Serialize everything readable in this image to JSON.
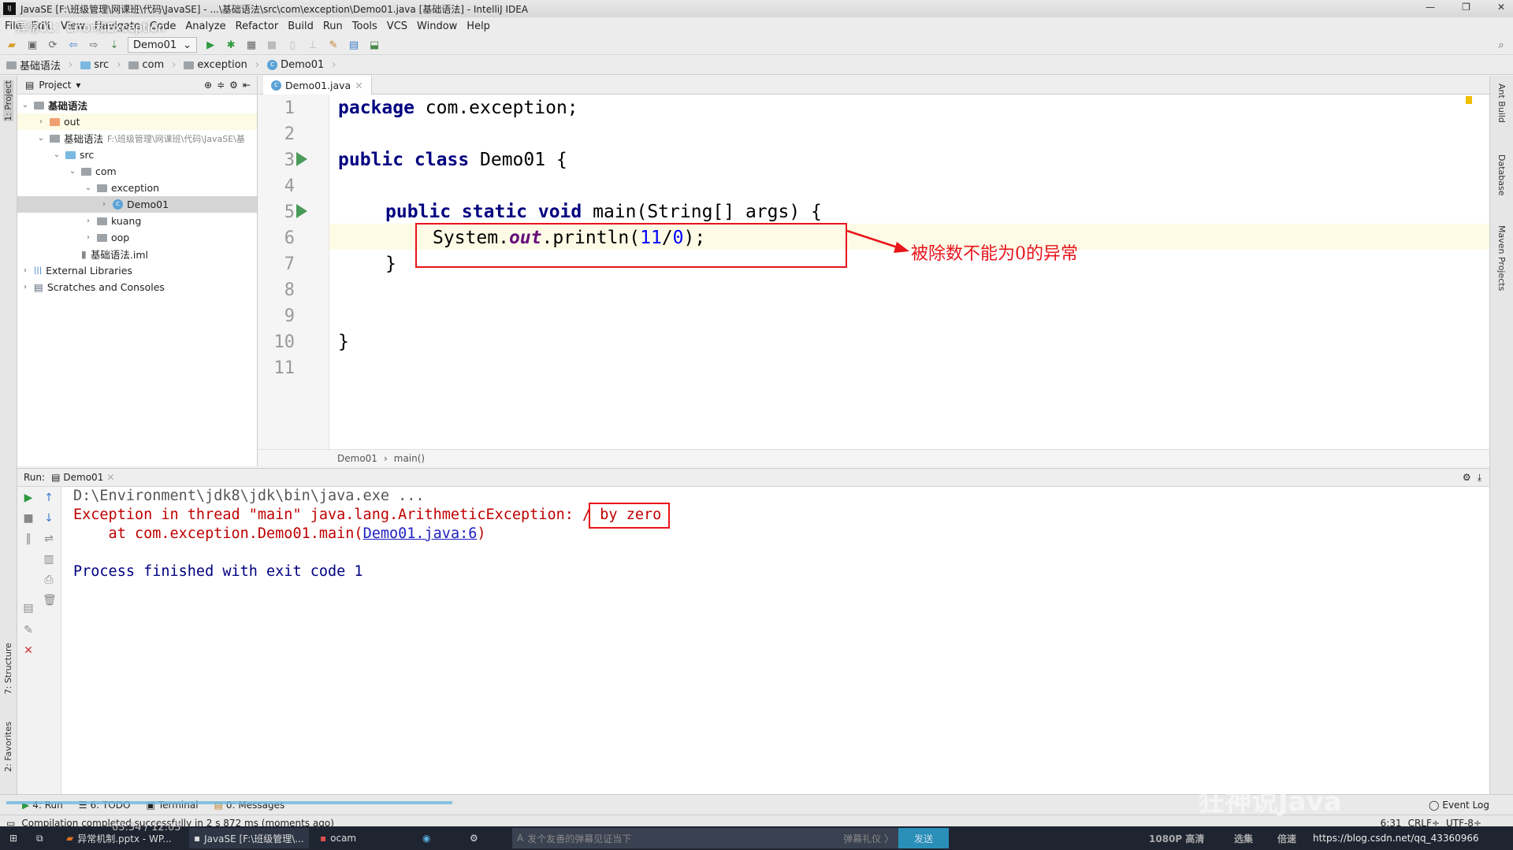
{
  "window": {
    "title": "JavaSE [F:\\班级管理\\网课班\\代码\\JavaSE] - ...\\基础语法\\src\\com\\exception\\Demo01.java [基础语法] - IntelliJ IDEA",
    "logo": "IJ",
    "video_title_overlay": "异常01：Error和Exception"
  },
  "menu": [
    "File",
    "Edit",
    "View",
    "Navigate",
    "Code",
    "Analyze",
    "Refactor",
    "Build",
    "Run",
    "Tools",
    "VCS",
    "Window",
    "Help"
  ],
  "toolbar": {
    "run_config": "Demo01"
  },
  "navbar": [
    "基础语法",
    "src",
    "com",
    "exception",
    "Demo01"
  ],
  "left_strip": {
    "project": "1: Project",
    "structure": "7: Structure",
    "favorites": "2: Favorites"
  },
  "right_strip": {
    "ant": "Ant Build",
    "database": "Database",
    "maven": "Maven Projects"
  },
  "project_panel": {
    "title": "Project",
    "tree": [
      {
        "label": "基础语法",
        "depth": 0,
        "expanded": true,
        "icon": "module-folder"
      },
      {
        "label": "out",
        "depth": 1,
        "expanded": false,
        "icon": "orange-folder"
      },
      {
        "label": "基础语法",
        "path": "F:\\班级管理\\网课班\\代码\\JavaSE\\基",
        "depth": 1,
        "expanded": true,
        "icon": "module-folder"
      },
      {
        "label": "src",
        "depth": 2,
        "expanded": true,
        "icon": "source-folder"
      },
      {
        "label": "com",
        "depth": 3,
        "expanded": true,
        "icon": "package-folder"
      },
      {
        "label": "exception",
        "depth": 4,
        "expanded": true,
        "icon": "package-folder"
      },
      {
        "label": "Demo01",
        "depth": 5,
        "expanded": false,
        "icon": "class",
        "selected": true
      },
      {
        "label": "kuang",
        "depth": 4,
        "expanded": false,
        "icon": "package-folder"
      },
      {
        "label": "oop",
        "depth": 4,
        "expanded": false,
        "icon": "package-folder"
      },
      {
        "label": "基础语法.iml",
        "depth": 3,
        "icon": "iml-file"
      },
      {
        "label": "External Libraries",
        "depth": 0,
        "expanded": false,
        "icon": "libraries"
      },
      {
        "label": "Scratches and Consoles",
        "depth": 0,
        "expanded": false,
        "icon": "scratches"
      }
    ]
  },
  "editor": {
    "tab": "Demo01.java",
    "line_numbers": [
      "1",
      "2",
      "3",
      "4",
      "5",
      "6",
      "7",
      "8",
      "9",
      "10",
      "11"
    ],
    "code": {
      "l1a": "package",
      "l1b": " com.exception;",
      "l3a": "public class",
      "l3b": " Demo01 {",
      "l5a": "public static void",
      "l5b": " main(String[] args) {",
      "l6a": "System.",
      "l6b": "out",
      "l6c": ".println(",
      "l6d": "11",
      "l6e": "/",
      "l6f": "0",
      "l6g": ");",
      "l7": "}",
      "l10": "}"
    },
    "breadcrumb": [
      "Demo01",
      "main()"
    ],
    "annotation": "被除数不能为0的异常"
  },
  "run": {
    "label": "Run:",
    "tab": "Demo01",
    "output": {
      "cmd": "D:\\Environment\\jdk8\\jdk\\bin\\java.exe ...",
      "exc": "Exception in thread \"main\" java.lang.ArithmeticException: / by zero",
      "at_prefix": "    at com.exception.Demo01.main(",
      "at_link": "Demo01.java:6",
      "at_suffix": ")",
      "finish": "Process finished with exit code 1"
    }
  },
  "bottom_tabs": [
    "4: Run",
    "6: TODO",
    "Terminal",
    "0: Messages"
  ],
  "event_log": "Event Log",
  "status": {
    "message": "Compilation completed successfully in 2 s 872 ms (moments ago)",
    "position": "6:31",
    "line_sep": "CRLF÷",
    "encoding": "UTF-8÷"
  },
  "video_overlay": {
    "time": "03:34 / 12:03",
    "danmaku_placeholder": "发个友善的弹幕见证当下",
    "danmaku_etiquette": "弹幕礼仪 〉",
    "send": "发送",
    "quality": "1080P 高清",
    "episodes": "选集",
    "speed": "倍速",
    "watermark": "狂神说Java",
    "url": "https://blog.csdn.net/qq_43360966"
  },
  "taskbar": [
    {
      "label": "异常机制.pptx - WP..."
    },
    {
      "label": "JavaSE [F:\\班级管理\\..."
    },
    {
      "label": "ocam"
    }
  ],
  "colors": {
    "keyword": "#000080",
    "number": "#0000ff",
    "error": "#c00000",
    "highlight_box": "#e8141b",
    "link": "#2020c0"
  }
}
